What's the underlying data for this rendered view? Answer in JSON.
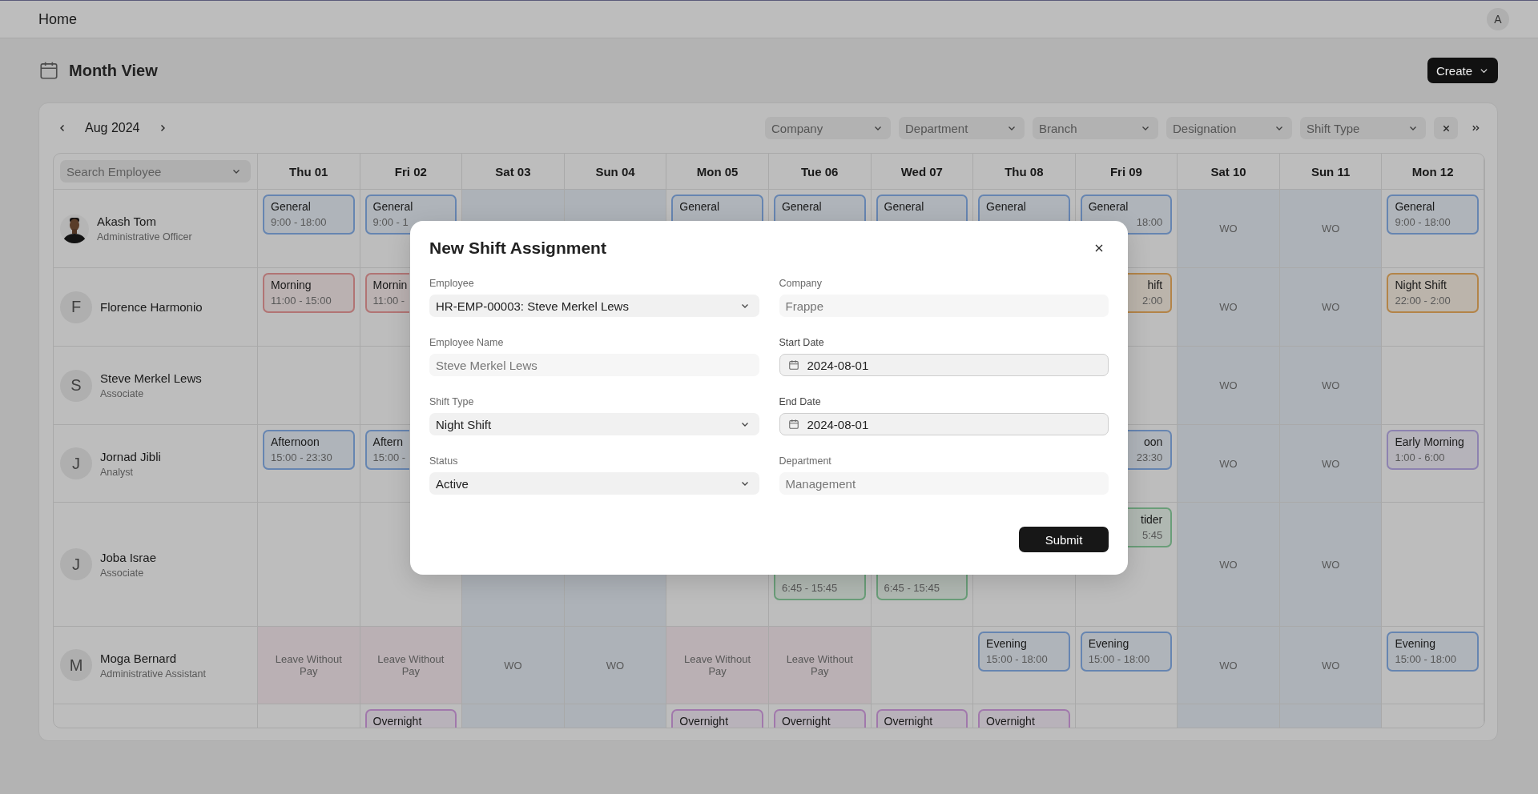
{
  "topbar": {
    "title": "Home",
    "avatar": "A"
  },
  "header": {
    "title": "Month View",
    "create_button": "Create"
  },
  "toolbar": {
    "month": "Aug 2024",
    "filters": [
      "Company",
      "Department",
      "Branch",
      "Designation",
      "Shift Type"
    ]
  },
  "grid": {
    "search_placeholder": "Search Employee",
    "days": [
      {
        "label": "Thu 01",
        "weekend": false
      },
      {
        "label": "Fri 02",
        "weekend": false
      },
      {
        "label": "Sat 03",
        "weekend": true
      },
      {
        "label": "Sun 04",
        "weekend": true
      },
      {
        "label": "Mon 05",
        "weekend": false
      },
      {
        "label": "Tue 06",
        "weekend": false
      },
      {
        "label": "Wed 07",
        "weekend": false
      },
      {
        "label": "Thu 08",
        "weekend": false
      },
      {
        "label": "Fri 09",
        "weekend": false
      },
      {
        "label": "Sat 10",
        "weekend": true
      },
      {
        "label": "Sun 11",
        "weekend": true
      },
      {
        "label": "Mon 12",
        "weekend": false
      }
    ],
    "rows": [
      {
        "name": "Akash Tom",
        "role": "Administrative Officer",
        "cells": [
          {
            "kind": "shift",
            "title": "General",
            "time": "9:00 - 18:00",
            "color": "#6685b1"
          },
          {
            "kind": "shift",
            "title": "General",
            "time": "9:00 - 1",
            "color": "#6685b1"
          },
          {
            "kind": "empty"
          },
          {
            "kind": "empty"
          },
          {
            "kind": "shift",
            "title": "General",
            "color": "#6685b1"
          },
          {
            "kind": "shift",
            "title": "General",
            "color": "#6685b1"
          },
          {
            "kind": "shift",
            "title": "General",
            "color": "#6685b1"
          },
          {
            "kind": "shift",
            "title": "General",
            "color": "#6685b1"
          },
          {
            "kind": "shift",
            "title": "General",
            "time": "18:00",
            "time_cut": true,
            "color": "#6685b1"
          },
          {
            "kind": "wo",
            "text": "WO"
          },
          {
            "kind": "wo",
            "text": "WO"
          },
          {
            "kind": "shift",
            "title": "General",
            "time": "9:00 - 18:00",
            "color": "#6685b1"
          }
        ]
      },
      {
        "name": "Florence Harmonio",
        "avatar": {
          "kind": "initial",
          "text": "F"
        },
        "cells": [
          {
            "kind": "shift",
            "title": "Morning",
            "time": "11:00 - 15:00",
            "color": "#b17474"
          },
          {
            "kind": "shift",
            "title": "Mornin",
            "time": "11:00 -",
            "cut_end": true,
            "color": "#b17474"
          },
          {
            "kind": "empty"
          },
          {
            "kind": "empty"
          },
          {
            "kind": "empty"
          },
          {
            "kind": "empty"
          },
          {
            "kind": "empty"
          },
          {
            "kind": "empty"
          },
          {
            "kind": "shift",
            "title": "hift",
            "time": "2:00",
            "cut_start": true,
            "color": "#b38448"
          },
          {
            "kind": "wo",
            "text": "WO"
          },
          {
            "kind": "wo",
            "text": "WO"
          },
          {
            "kind": "shift",
            "title": "Night Shift",
            "time": "22:00 - 2:00",
            "color": "#b38448"
          }
        ]
      },
      {
        "name": "Steve Merkel Lews",
        "role": "Associate",
        "avatar": {
          "kind": "initial",
          "text": "S"
        },
        "cells": [
          {
            "kind": "empty"
          },
          {
            "kind": "empty"
          },
          {
            "kind": "empty"
          },
          {
            "kind": "empty"
          },
          {
            "kind": "empty"
          },
          {
            "kind": "empty"
          },
          {
            "kind": "empty"
          },
          {
            "kind": "empty"
          },
          {
            "kind": "empty"
          },
          {
            "kind": "wo",
            "text": "WO"
          },
          {
            "kind": "wo",
            "text": "WO"
          },
          {
            "kind": "empty"
          }
        ]
      },
      {
        "name": "Jornad Jibli",
        "role": "Analyst",
        "avatar": {
          "kind": "initial",
          "text": "J"
        },
        "cells": [
          {
            "kind": "shift",
            "title": "Afternoon",
            "time": "15:00 - 23:30",
            "color": "#6685b1"
          },
          {
            "kind": "shift",
            "title": "Aftern",
            "time": "15:00 -",
            "cut_end": true,
            "color": "#6685b1"
          },
          {
            "kind": "empty"
          },
          {
            "kind": "empty"
          },
          {
            "kind": "empty"
          },
          {
            "kind": "empty"
          },
          {
            "kind": "empty"
          },
          {
            "kind": "empty"
          },
          {
            "kind": "shift",
            "title": "oon",
            "time": "23:30",
            "cut_start": true,
            "color": "#6685b1"
          },
          {
            "kind": "wo",
            "text": "WO"
          },
          {
            "kind": "wo",
            "text": "WO"
          },
          {
            "kind": "shift",
            "title": "Early Morning",
            "time": "1:00 - 6:00",
            "color": "#8d82b0"
          }
        ]
      },
      {
        "name": "Joba Israe",
        "role": "Associate",
        "avatar": {
          "kind": "initial",
          "text": "J"
        },
        "cells": [
          {
            "kind": "empty"
          },
          {
            "kind": "empty"
          },
          {
            "kind": "empty"
          },
          {
            "kind": "empty"
          },
          {
            "kind": "empty"
          },
          {
            "kind": "shift",
            "time": "6:45 - 15:45",
            "color": "#6a9e79"
          },
          {
            "kind": "shift",
            "time": "6:45 - 15:45",
            "color": "#6a9e79"
          },
          {
            "kind": "empty"
          },
          {
            "kind": "shift",
            "title": "tider",
            "time": "5:45",
            "cut_start": true,
            "color": "#6a9e79"
          },
          {
            "kind": "wo",
            "text": "WO"
          },
          {
            "kind": "wo",
            "text": "WO"
          },
          {
            "kind": "empty"
          }
        ]
      },
      {
        "name": "Moga Bernard",
        "role": "Administrative Assistant",
        "avatar": {
          "kind": "initial",
          "text": "M"
        },
        "cells": [
          {
            "kind": "leave",
            "text": "Leave Without Pay"
          },
          {
            "kind": "leave",
            "text": "Leave Without Pay"
          },
          {
            "kind": "wo",
            "text": "WO"
          },
          {
            "kind": "wo",
            "text": "WO"
          },
          {
            "kind": "leave",
            "text": "Leave Without Pay"
          },
          {
            "kind": "leave",
            "text": "Leave Without Pay"
          },
          {
            "kind": "empty"
          },
          {
            "kind": "shift",
            "title": "Evening",
            "time": "15:00 - 18:00",
            "color": "#6685b1"
          },
          {
            "kind": "shift",
            "title": "Evening",
            "time": "15:00 - 18:00",
            "color": "#6685b1"
          },
          {
            "kind": "wo",
            "text": "WO"
          },
          {
            "kind": "wo",
            "text": "WO"
          },
          {
            "kind": "shift",
            "title": "Evening",
            "time": "15:00 - 18:00",
            "color": "#6685b1"
          }
        ]
      },
      {
        "cells": [
          {
            "kind": "empty"
          },
          {
            "kind": "shift",
            "title": "Overnight",
            "color": "#a178ac"
          },
          {
            "kind": "empty"
          },
          {
            "kind": "empty"
          },
          {
            "kind": "shift",
            "title": "Overnight",
            "color": "#a178ac"
          },
          {
            "kind": "shift",
            "title": "Overnight",
            "color": "#a178ac"
          },
          {
            "kind": "shift",
            "title": "Overnight",
            "color": "#a178ac"
          },
          {
            "kind": "shift",
            "title": "Overnight",
            "color": "#a178ac"
          },
          {
            "kind": "empty"
          },
          {
            "kind": "empty"
          },
          {
            "kind": "empty"
          },
          {
            "kind": "empty"
          }
        ]
      }
    ]
  },
  "modal": {
    "title": "New Shift Assignment",
    "submit": "Submit",
    "left": [
      {
        "label": "Employee",
        "value": "HR-EMP-00003: Steve Merkel Lews",
        "kind": "select"
      },
      {
        "label": "Employee Name",
        "value": "Steve Merkel Lews",
        "kind": "readonly"
      },
      {
        "label": "Shift Type",
        "value": "Night Shift",
        "kind": "select"
      },
      {
        "label": "Status",
        "value": "Active",
        "kind": "select"
      }
    ],
    "right": [
      {
        "label": "Company",
        "value": "Frappe",
        "kind": "readonly"
      },
      {
        "label": "Start Date",
        "value": "2024-08-01",
        "kind": "date"
      },
      {
        "label": "End Date",
        "value": "2024-08-01",
        "kind": "date"
      },
      {
        "label": "Department",
        "value": "Management",
        "kind": "readonly"
      }
    ]
  }
}
